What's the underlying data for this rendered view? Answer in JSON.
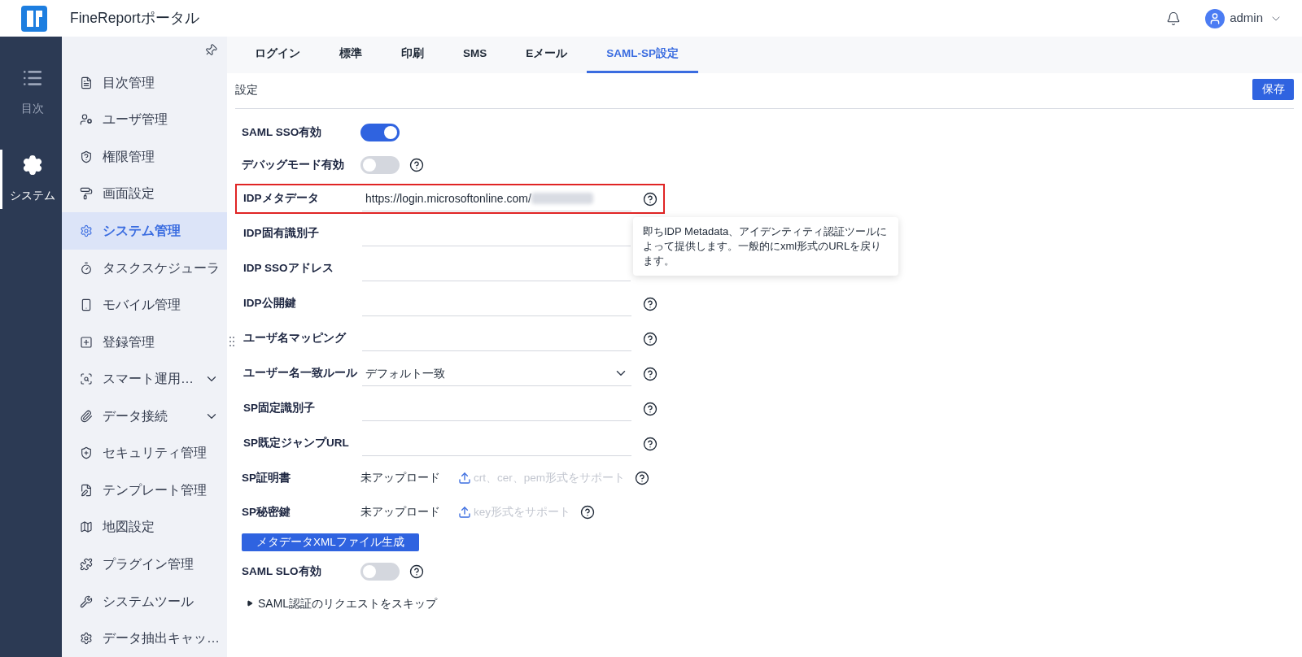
{
  "header": {
    "title": "FineReportポータル",
    "user": "admin"
  },
  "rail": [
    {
      "label": "目次",
      "selected": false
    },
    {
      "label": "システム",
      "selected": true
    }
  ],
  "sidebar": {
    "items": [
      {
        "label": "目次管理",
        "selected": false,
        "expandable": false
      },
      {
        "label": "ユーザ管理",
        "selected": false,
        "expandable": false
      },
      {
        "label": "権限管理",
        "selected": false,
        "expandable": false
      },
      {
        "label": "画面設定",
        "selected": false,
        "expandable": false
      },
      {
        "label": "システム管理",
        "selected": true,
        "expandable": false
      },
      {
        "label": "タスクスケジューラ",
        "selected": false,
        "expandable": false
      },
      {
        "label": "モバイル管理",
        "selected": false,
        "expandable": false
      },
      {
        "label": "登録管理",
        "selected": false,
        "expandable": false
      },
      {
        "label": "スマート運用…",
        "selected": false,
        "expandable": true
      },
      {
        "label": "データ接続",
        "selected": false,
        "expandable": true
      },
      {
        "label": "セキュリティ管理",
        "selected": false,
        "expandable": false
      },
      {
        "label": "テンプレート管理",
        "selected": false,
        "expandable": false
      },
      {
        "label": "地図設定",
        "selected": false,
        "expandable": false
      },
      {
        "label": "プラグイン管理",
        "selected": false,
        "expandable": false
      },
      {
        "label": "システムツール",
        "selected": false,
        "expandable": false
      },
      {
        "label": "データ抽出キャッ…",
        "selected": false,
        "expandable": false
      }
    ]
  },
  "tabs": [
    {
      "label": "ログイン",
      "selected": false
    },
    {
      "label": "標準",
      "selected": false
    },
    {
      "label": "印刷",
      "selected": false
    },
    {
      "label": "SMS",
      "selected": false
    },
    {
      "label": "Eメール",
      "selected": false
    },
    {
      "label": "SAML-SP設定",
      "selected": true
    }
  ],
  "section": {
    "title": "設定",
    "save_button": "保存"
  },
  "fields": [
    {
      "kind": "toggle",
      "label": "SAML SSO有効",
      "on": true
    },
    {
      "kind": "toggle",
      "label": "デバッグモード有効",
      "on": false,
      "help": true
    },
    {
      "kind": "input",
      "label": "IDPメタデータ",
      "value": "https://login.microsoftonline.com/",
      "redacted": true,
      "highlighted": true,
      "help": true
    },
    {
      "kind": "input",
      "label": "IDP固有識別子"
    },
    {
      "kind": "input",
      "label": "IDP SSOアドレス"
    },
    {
      "kind": "input",
      "label": "IDP公開鍵",
      "help": true
    },
    {
      "kind": "input",
      "label": "ユーザ名マッピング",
      "help": true
    },
    {
      "kind": "select",
      "label": "ユーザー名一致ルール",
      "value": "デフォルト一致",
      "help": true
    },
    {
      "kind": "input",
      "label": "SP固定識別子",
      "help": true
    },
    {
      "kind": "input",
      "label": "SP既定ジャンプURL",
      "help": true
    },
    {
      "kind": "upload",
      "label": "SP証明書",
      "status": "未アップロード",
      "hint": "crt、cer、pem形式をサポート",
      "help": true
    },
    {
      "kind": "upload",
      "label": "SP秘密鍵",
      "status": "未アップロード",
      "hint": "key形式をサポート",
      "help": true
    },
    {
      "kind": "button",
      "label": "メタデータXMLファイル生成"
    },
    {
      "kind": "toggle",
      "label": "SAML SLO有効",
      "on": false,
      "help": true
    },
    {
      "kind": "disclosure",
      "label": "SAML認証のリクエストをスキップ",
      "expanded": false
    }
  ],
  "tooltip": {
    "text": "即ちIDP Metadata、アイデンティティ認証ツールによって提供します。一般的にxml形式のURLを戻ります。"
  }
}
